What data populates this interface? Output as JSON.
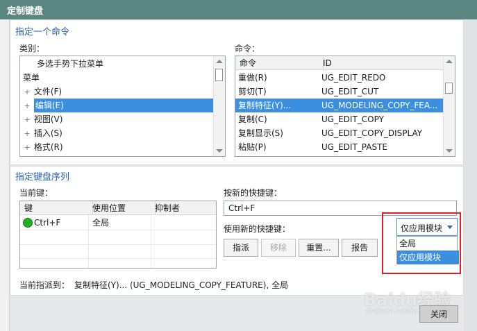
{
  "window": {
    "title": "定制键盘"
  },
  "assign_command": {
    "section_title": "指定一个命令",
    "category_label": "类别：",
    "categories": [
      {
        "label": "多选手势下拉菜单",
        "indent": 2,
        "expander": ""
      },
      {
        "label": "菜单",
        "indent": 0,
        "expander": ""
      },
      {
        "label": "文件(F)",
        "indent": 1,
        "expander": "+"
      },
      {
        "label": "编辑(E)",
        "indent": 1,
        "expander": "+",
        "selected": true
      },
      {
        "label": "视图(V)",
        "indent": 1,
        "expander": "+"
      },
      {
        "label": "插入(S)",
        "indent": 1,
        "expander": "+"
      },
      {
        "label": "格式(R)",
        "indent": 1,
        "expander": "+"
      }
    ],
    "command_label": "命令：",
    "command_columns": [
      "命令",
      "ID"
    ],
    "commands": [
      {
        "name": "重做(R)",
        "id": "UG_EDIT_REDO"
      },
      {
        "name": "剪切(T)",
        "id": "UG_EDIT_CUT"
      },
      {
        "name": "复制特征(Y)...",
        "id": "UG_MODELING_COPY_FEA...",
        "selected": true
      },
      {
        "name": "复制(C)",
        "id": "UG_EDIT_COPY"
      },
      {
        "name": "复制显示(S)",
        "id": "UG_EDIT_COPY_DISPLAY"
      },
      {
        "name": "粘贴(P)",
        "id": "UG_EDIT_PASTE"
      }
    ]
  },
  "key_sequence": {
    "section_title": "指定键盘序列",
    "current_keys_label": "当前键：",
    "current_columns": [
      "键",
      "使用位置",
      "抑制者"
    ],
    "current_keys": [
      {
        "key": "Ctrl+F",
        "location": "全局",
        "suppressed_by": ""
      }
    ],
    "new_shortcut_label": "按新的快捷键：",
    "new_shortcut_value": "Ctrl+F",
    "use_new_label": "使用新的快捷键：",
    "scope_selected": "仅应用模块",
    "scope_options": [
      "全局",
      "仅应用模块"
    ],
    "buttons": {
      "assign": "指派",
      "remove": "移除",
      "reset": "重置...",
      "report": "报告"
    },
    "assigned_to_label": "当前指派到：",
    "assigned_to_value": "复制特征(Y)... (UG_MODELING_COPY_FEATURE), 全局"
  },
  "footer": {
    "close": "关闭"
  },
  "watermark": {
    "brand": "Baidu经验",
    "url": "jingyan.baidu.com"
  },
  "colors": {
    "accent": "#2a62b3",
    "selection": "#3b8fde",
    "titlebar": "#5b8580",
    "highlight_box": "#e02020"
  }
}
